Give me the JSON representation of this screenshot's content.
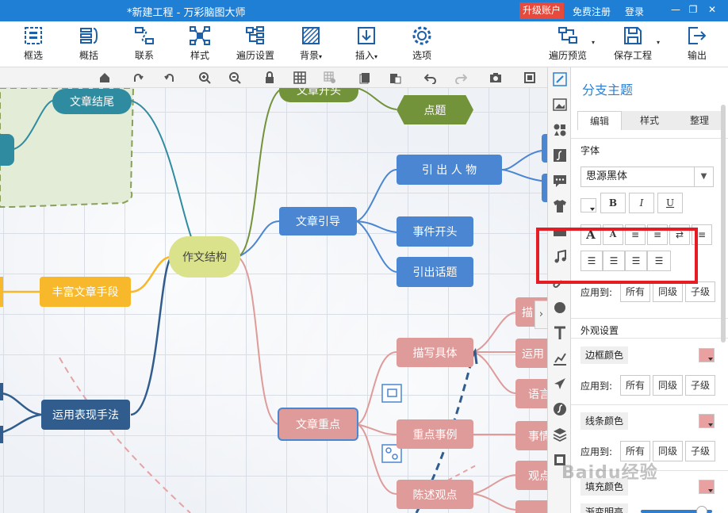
{
  "window": {
    "title": "*新建工程 - 万彩脑图大师",
    "upgrade": "升级账户",
    "register": "免费注册",
    "login": "登录"
  },
  "toolbar": {
    "items": [
      {
        "label": "框选",
        "icon": "frame-select-icon"
      },
      {
        "label": "概括",
        "icon": "summary-icon"
      },
      {
        "label": "联系",
        "icon": "relation-icon"
      },
      {
        "label": "样式",
        "icon": "style-icon"
      },
      {
        "label": "遍历设置",
        "icon": "traverse-settings-icon"
      },
      {
        "label": "背景",
        "icon": "background-icon"
      },
      {
        "label": "插入",
        "icon": "insert-icon"
      },
      {
        "label": "选项",
        "icon": "options-icon"
      },
      {
        "label": "遍历预览",
        "icon": "traverse-preview-icon"
      },
      {
        "label": "保存工程",
        "icon": "save-icon"
      },
      {
        "label": "输出",
        "icon": "export-icon"
      }
    ]
  },
  "mindmap": {
    "center": "作文结构",
    "nodes": {
      "article_start": "文章开头",
      "point_topic": "点题",
      "intro": "文章引导",
      "intro_character": "引 出 人 物",
      "event_start": "事件开头",
      "intro_topic": "引出话题",
      "article_end": "文章结尾",
      "rich_means": "丰富文章手段",
      "expression": "运用表现手法",
      "key_point": "文章重点",
      "describe": "描写具体",
      "key_example": "重点事例",
      "state_view": "陈述观点",
      "cut1": "描",
      "cut2": "运用",
      "cut3": "语言",
      "cut4": "事情",
      "cut5": "观点"
    }
  },
  "panel": {
    "title": "分支主题",
    "tabs": [
      "编辑",
      "样式",
      "整理"
    ],
    "font_section": "字体",
    "font_name": "思源黑体",
    "bold": "B",
    "italic": "I",
    "underline": "U",
    "apply_to": "应用到:",
    "apply_all": "所有",
    "apply_same": "同级",
    "apply_child": "子级",
    "appearance": "外观设置",
    "border_color": "边框颜色",
    "line_color": "线条颜色",
    "fill_color": "填充颜色",
    "gradient": "渐变明亮",
    "swatch_color": "#e8a0a0"
  },
  "watermark": "Baidu经验"
}
